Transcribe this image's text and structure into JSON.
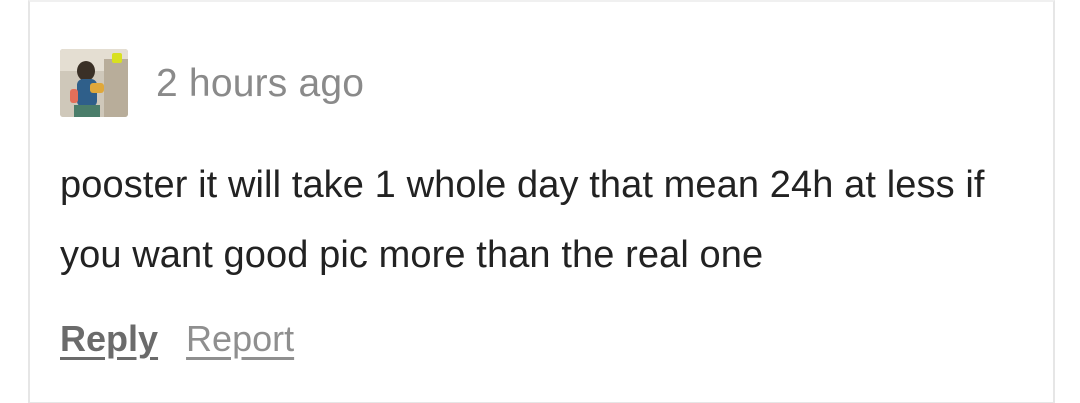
{
  "comment": {
    "avatar_icon": "user-avatar-photo",
    "timestamp": "2 hours ago",
    "body": "pooster it will take 1 whole day that mean 24h at less if you want good pic more than the real one",
    "actions": {
      "reply_label": "Reply",
      "report_label": "Report"
    }
  },
  "colors": {
    "text": "#222222",
    "muted": "#8a8a8a",
    "border": "#e6e6e6"
  }
}
